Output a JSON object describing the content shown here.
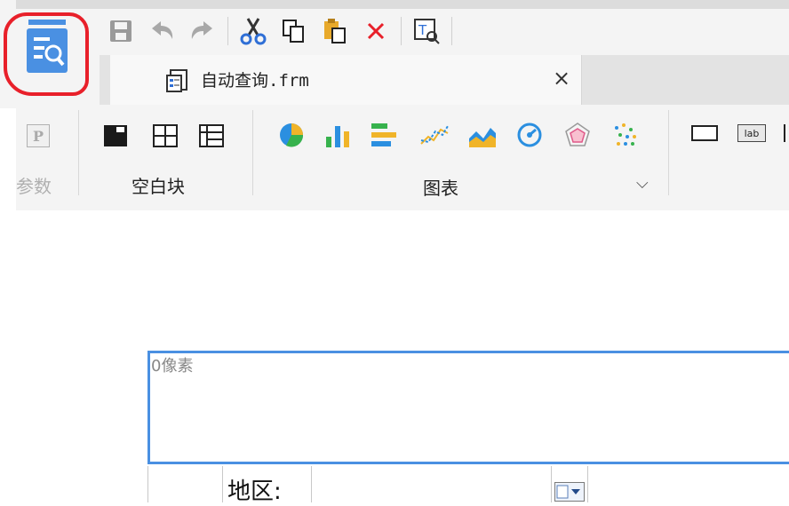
{
  "app": {
    "logo_icon": "query-form-icon",
    "accent": "#4a90e2",
    "highlight_color": "#e8202a"
  },
  "toolbar": {
    "buttons": [
      "save-icon",
      "undo-icon",
      "redo-icon",
      "cut-icon",
      "copy-icon",
      "paste-icon",
      "delete-icon",
      "text-format-icon"
    ]
  },
  "tabs": {
    "doc_tab_label": "自动查询.frm",
    "close_glyph": "×"
  },
  "ribbon": {
    "param_group_label": "参数",
    "param_icon_letter": "P",
    "blank_group_label": "空白块",
    "chart_group_label": "图表",
    "expand_glyph": "⌵",
    "widget_lab": "lab"
  },
  "canvas": {
    "height_label": "0像素",
    "field_label": "地区:"
  }
}
